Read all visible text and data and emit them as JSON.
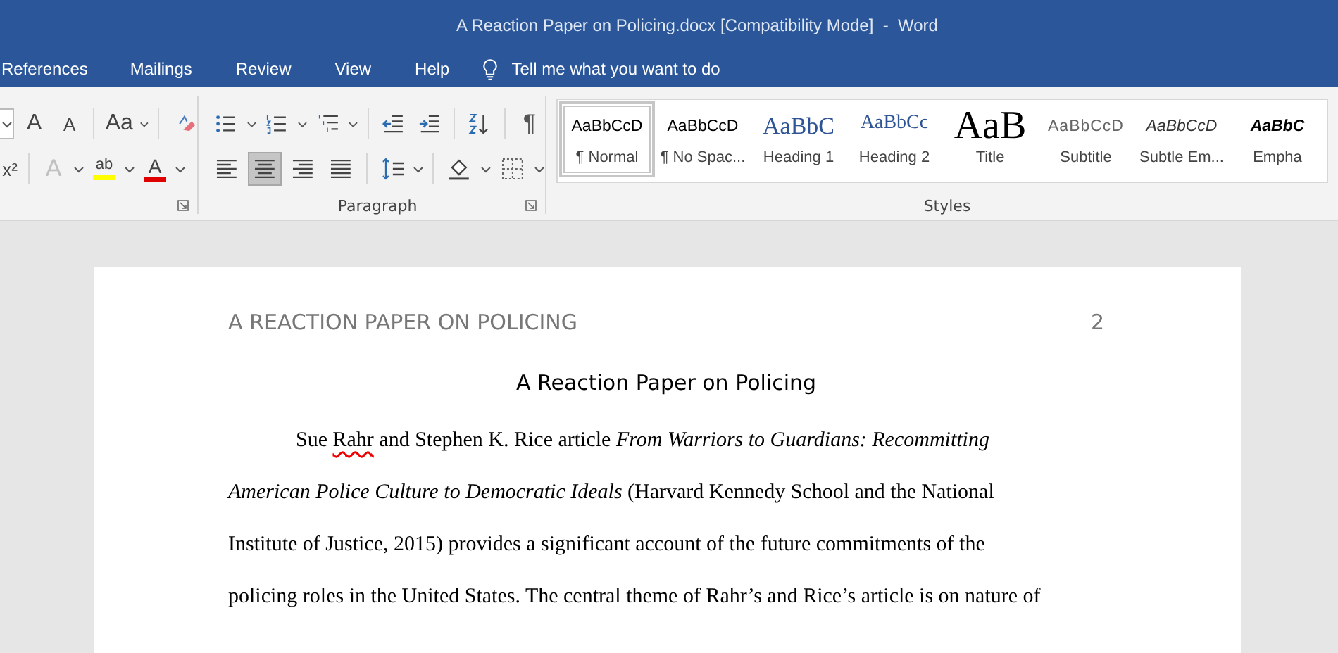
{
  "window": {
    "title": "A Reaction Paper on Policing.docx [Compatibility Mode]  -  Word"
  },
  "menu_tabs": [
    {
      "label": "References"
    },
    {
      "label": "Mailings"
    },
    {
      "label": "Review"
    },
    {
      "label": "View"
    },
    {
      "label": "Help"
    }
  ],
  "tell_me": {
    "placeholder": "Tell me what you want to do"
  },
  "font_group": {
    "row_1": [
      {
        "kind": "size-dropdown"
      },
      {
        "kind": "grow",
        "label": "A"
      },
      {
        "kind": "shrink",
        "label": "A"
      },
      {
        "kind": "case",
        "label": "Aa"
      },
      {
        "kind": "clear"
      }
    ],
    "row_2": [
      {
        "kind": "superscript",
        "label": "x²"
      },
      {
        "kind": "effects",
        "label": "A"
      },
      {
        "kind": "highlight",
        "label": "ab",
        "color": "#ffff00"
      },
      {
        "kind": "font-color",
        "label": "A",
        "color": "#e00000"
      }
    ]
  },
  "paragraph_group": {
    "label": "Paragraph",
    "row_1": [
      {
        "kind": "bullets",
        "selected": false
      },
      {
        "kind": "numbering",
        "selected": false
      },
      {
        "kind": "multilevel",
        "selected": false
      },
      {
        "kind": "decrease-indent",
        "selected": false
      },
      {
        "kind": "increase-indent",
        "selected": false
      },
      {
        "kind": "sort",
        "selected": false
      },
      {
        "kind": "pilcrow",
        "label": "¶",
        "selected": false
      }
    ],
    "row_2": [
      {
        "kind": "align-left",
        "selected": false
      },
      {
        "kind": "align-center",
        "selected": true
      },
      {
        "kind": "align-right",
        "selected": false
      },
      {
        "kind": "justify",
        "selected": false
      },
      {
        "kind": "line-spacing",
        "selected": false
      },
      {
        "kind": "shading",
        "selected": false
      },
      {
        "kind": "borders",
        "selected": false
      }
    ]
  },
  "styles_group": {
    "label": "Styles",
    "items": [
      {
        "kind": "normal",
        "preview": "AaBbCcD",
        "name": "¶ Normal",
        "selected": true
      },
      {
        "kind": "normal",
        "preview": "AaBbCcD",
        "name": "¶ No Spac...",
        "selected": false
      },
      {
        "kind": "heading1",
        "preview": "AaBbC",
        "name": "Heading 1",
        "selected": false
      },
      {
        "kind": "heading2",
        "preview": "AaBbCc",
        "name": "Heading 2",
        "selected": false
      },
      {
        "kind": "title",
        "preview": "AaB",
        "name": "Title",
        "selected": false
      },
      {
        "kind": "subtitle",
        "preview": "AaBbCcD",
        "name": "Subtitle",
        "selected": false
      },
      {
        "kind": "emphasis",
        "preview": "AaBbCcD",
        "name": "Subtle Em...",
        "selected": false
      },
      {
        "kind": "emphasis-strong",
        "preview": "AaBbC",
        "name": "Empha",
        "selected": false
      }
    ]
  },
  "document": {
    "running_head": "A REACTION PAPER ON POLICING",
    "page_number": "2",
    "title": "A Reaction Paper on Policing",
    "paragraphs": [
      {
        "segments": [
          {
            "kind": "normal",
            "text": "Sue "
          },
          {
            "kind": "misspelled",
            "text": "Rahr"
          },
          {
            "kind": "normal",
            "text": " and Stephen K. Rice article "
          },
          {
            "kind": "italic",
            "text": "From Warriors to Guardians: Recommitting American Police Culture to Democratic Ideals"
          },
          {
            "kind": "normal",
            "text": " (Harvard Kennedy School and the National Institute of Justice, 2015) provides a significant account of the future commitments of the policing roles in the United States. The central theme of Rahr’s and Rice’s article is on nature of"
          }
        ]
      }
    ]
  }
}
